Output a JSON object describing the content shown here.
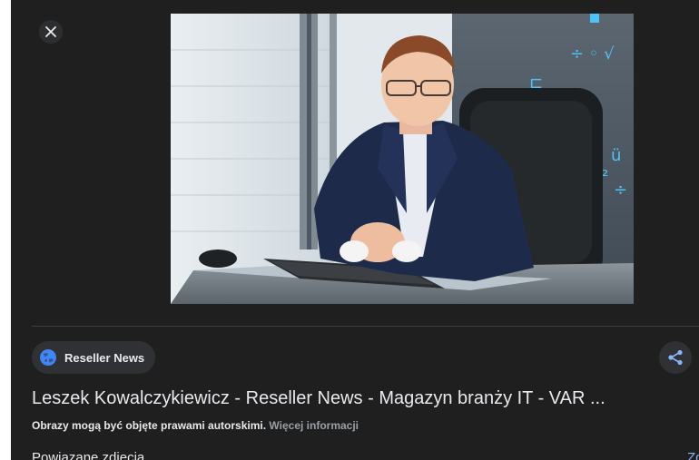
{
  "viewer": {
    "close_icon": "close-icon",
    "image_alt": "Leszek Kowalczykiewicz",
    "source": {
      "icon": "globe-icon",
      "label": "Reseller News"
    },
    "share_icon": "share-icon",
    "title": "Leszek Kowalczykiewicz - Reseller News - Magazyn branży IT - VAR ...",
    "copyright_text": "Obrazy mogą być objęte prawami autorskimi.",
    "more_info_link": "Więcej informacji",
    "related_heading": "Powiązane zdjęcia",
    "see_more_link": "Zo"
  },
  "colors": {
    "panel_bg": "#1f1f1f",
    "chip_bg": "#303134",
    "text_primary": "#e8eaed",
    "text_secondary": "#9aa0a6",
    "link_blue": "#8ab4f8",
    "globe_blue": "#4285f4"
  }
}
